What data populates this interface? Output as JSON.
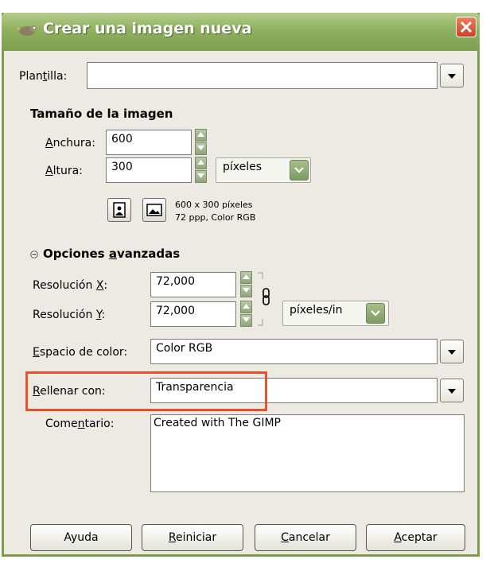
{
  "window": {
    "title": "Crear una imagen nueva",
    "title_icon": "gimp-icon",
    "close_icon": "close-icon"
  },
  "template": {
    "label_pre": "Plan",
    "label_key": "t",
    "label_post": "illa:",
    "value": ""
  },
  "image_size": {
    "heading": "Tamaño de la imagen",
    "width_key": "A",
    "width_rest": "nchura:",
    "width_value": "600",
    "height_key": "A",
    "height_rest": "ltura:",
    "height_value": "300",
    "unit": "píxeles",
    "info_line1": "600 x 300 píxeles",
    "info_line2": "72 ppp, Color RGB"
  },
  "advanced": {
    "expander_icon": "collapse-icon",
    "heading_pre": "Opciones ",
    "heading_key": "a",
    "heading_post": "vanzadas",
    "res_x_pre": "Resolución ",
    "res_x_key": "X",
    "res_x_post": ":",
    "res_x_value": "72,000",
    "res_y_pre": "Resolución ",
    "res_y_key": "Y",
    "res_y_post": ":",
    "res_y_value": "72,000",
    "res_unit": "píxeles/in",
    "color_key": "E",
    "color_rest": "spacio de color:",
    "color_value": "Color RGB",
    "fill_key": "R",
    "fill_rest": "ellenar con:",
    "fill_value": "Transparencia",
    "comment_pre": "Come",
    "comment_key": "n",
    "comment_post": "tario:",
    "comment_value": "Created with The GIMP"
  },
  "buttons": {
    "help": "Ayuda",
    "reset_key": "R",
    "reset_rest": "einiciar",
    "cancel_key": "C",
    "cancel_rest": "ancelar",
    "ok_key": "A",
    "ok_rest": "ceptar"
  },
  "colors": {
    "titlebar": "#8fb05e",
    "highlight": "#e8512b",
    "dialog_bg": "#eceae2"
  }
}
